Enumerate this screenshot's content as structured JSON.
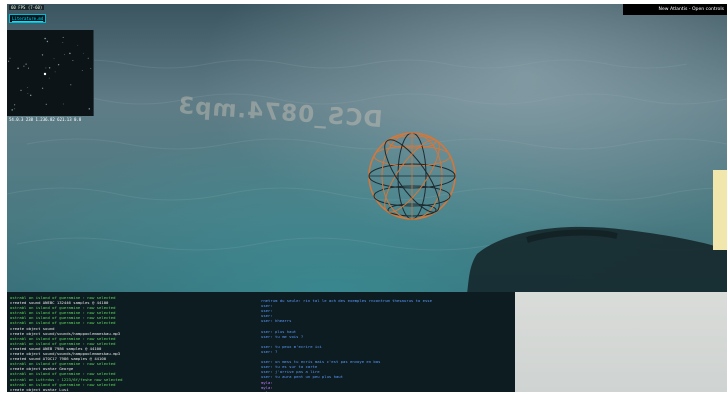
{
  "hud": {
    "fps": "60 FPS (7-60)",
    "library_link": "Literature.md",
    "coordinates": "54.0.3 238 1.236.82 621.13 0.8"
  },
  "topbar": {
    "label": "New Atlantis - Open controls"
  },
  "scene": {
    "floating_label": "DCS_0874.mp3"
  },
  "console": {
    "left_lines": [
      {
        "text": "ostrabl on island of gueramine : now selected",
        "color": "green"
      },
      {
        "text": "created sound ANEBC 132446 samples @ 44100",
        "color": "white"
      },
      {
        "text": "ostrabl on island of gueramine : now selected",
        "color": "green"
      },
      {
        "text": "ostrabl on island of gueramine : now selected",
        "color": "green"
      },
      {
        "text": "ostrabl on island of gueramine : now selected",
        "color": "green"
      },
      {
        "text": "ostrabl on island of gueramine : now selected",
        "color": "green"
      },
      {
        "text": "create object sound",
        "color": "white"
      },
      {
        "text": "create object sound/sounds/hamppoolemaeskau.mp3",
        "color": "white"
      },
      {
        "text": "ostrabl on island of gueramine : now selected",
        "color": "green"
      },
      {
        "text": "ostrabl on island of gueramine : now selected",
        "color": "green"
      },
      {
        "text": "created sound ANEB 7986 samples @ 44100",
        "color": "white"
      },
      {
        "text": "create object sound/sounds/hamppoolemaeskau.mp3",
        "color": "white"
      },
      {
        "text": "created sound ATOC17 7986 samples @ 44100",
        "color": "white"
      },
      {
        "text": "ostrabl on island of gueramine : now selected",
        "color": "green"
      },
      {
        "text": "create object avatar George",
        "color": "white"
      },
      {
        "text": "ostrabl on island of gueramine : now selected",
        "color": "green"
      },
      {
        "text": "ostrabl on Luttrdus : 1223/6f/feshe now selected",
        "color": "green"
      },
      {
        "text": "ostrabl on island of gueramine : now selected",
        "color": "green"
      },
      {
        "text": "create object avatar Lusi",
        "color": "white"
      },
      {
        "text": "ostrabl on island of gueramine : now selected",
        "color": "green"
      },
      {
        "text": "ostrabl on island of gueramine : now selected",
        "color": "green"
      },
      {
        "text": "ostrabl on island of gueramine : now selected",
        "color": "green"
      },
      {
        "text": "ostrabl on island of gueramine : now selected",
        "color": "green"
      }
    ],
    "right_lines": [
      {
        "text": "rnetrum du seule: rin tal le ach des exemples rncontrum thesaurus to esse",
        "color": "blue"
      },
      {
        "text": "user:",
        "color": "blue"
      },
      {
        "text": "user:",
        "color": "blue"
      },
      {
        "text": "user:",
        "color": "blue"
      },
      {
        "text": "user: hhearrs",
        "color": "blue"
      },
      {
        "text": "",
        "color": "blue"
      },
      {
        "text": "user: plus haut",
        "color": "blue"
      },
      {
        "text": "user: tu me vois ?",
        "color": "blue"
      },
      {
        "text": "",
        "color": "blue"
      },
      {
        "text": "user: tu peux m'ecrire ici",
        "color": "blue"
      },
      {
        "text": "user: ?",
        "color": "blue"
      },
      {
        "text": "",
        "color": "blue"
      },
      {
        "text": "user: un mess tu ecris mais c'est pas envoye en bas",
        "color": "blue"
      },
      {
        "text": "user: tu es sur ta carte",
        "color": "blue"
      },
      {
        "text": "user: j'arrive pas a lire",
        "color": "blue"
      },
      {
        "text": "user: tu aura pent un peu plus haut",
        "color": "blue"
      },
      {
        "text": "myla:",
        "color": "purple"
      },
      {
        "text": "myla:",
        "color": "purple"
      },
      {
        "text": "myla:",
        "color": "purple"
      }
    ]
  },
  "colors": {
    "sea_dark": "#243c46",
    "sea_light": "#4f8f99",
    "sphere_orange": "#d3773a",
    "sphere_dark": "#1d2a2f",
    "console_bg": "#0d1c20",
    "log_green": "#5fdc5f",
    "log_blue": "#5b9bff",
    "log_purple": "#c77bff"
  }
}
